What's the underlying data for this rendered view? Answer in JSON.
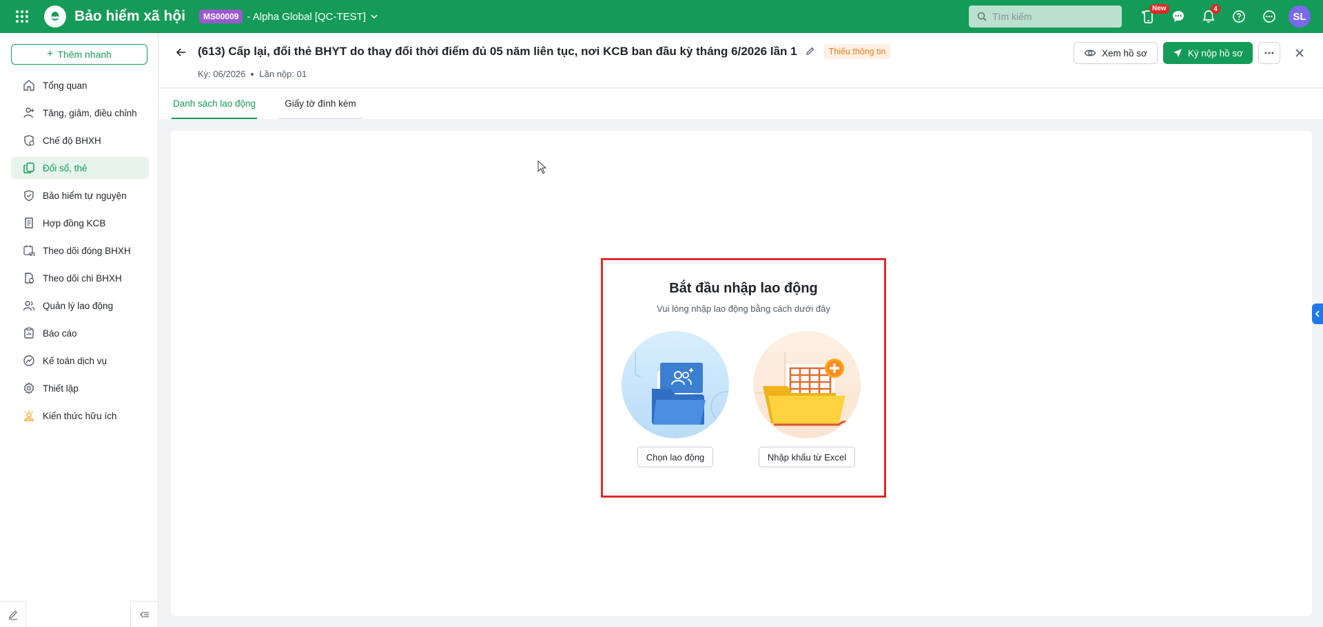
{
  "topbar": {
    "app_title": "Bảo hiểm xã hội",
    "org_code": "MS00009",
    "org_name": "- Alpha Global [QC-TEST]",
    "search_placeholder": "Tìm kiếm",
    "mobile_badge": "New",
    "notification_count": "4",
    "avatar_initials": "SL",
    "brand_color": "#149b57"
  },
  "sidebar": {
    "quick_add": "Thêm nhanh",
    "items": [
      {
        "label": "Tổng quan",
        "icon": "home-icon"
      },
      {
        "label": "Tăng, giảm, điều chỉnh",
        "icon": "user-adjust-icon"
      },
      {
        "label": "Chế độ BHXH",
        "icon": "shield-heart-icon"
      },
      {
        "label": "Đổi sổ, thẻ",
        "icon": "copy-card-icon"
      },
      {
        "label": "Bảo hiểm tự nguyện",
        "icon": "shield-icon"
      },
      {
        "label": "Hợp đồng KCB",
        "icon": "contract-icon"
      },
      {
        "label": "Theo dõi đóng BHXH",
        "icon": "calendar-c12-icon"
      },
      {
        "label": "Theo dõi chi BHXH",
        "icon": "document-money-icon"
      },
      {
        "label": "Quản lý lao động",
        "icon": "users-icon"
      },
      {
        "label": "Báo cáo",
        "icon": "clipboard-icon"
      },
      {
        "label": "Kế toán dịch vụ",
        "icon": "chart-circle-icon"
      },
      {
        "label": "Thiết lập",
        "icon": "gear-icon"
      },
      {
        "label": "Kiến thức hữu ích",
        "icon": "lightbulb-person-icon"
      }
    ],
    "active_index": 3
  },
  "header": {
    "title": "(613) Cấp lại, đổi thẻ BHYT do thay đổi thời điểm đủ 05 năm liên tục, nơi KCB ban đầu kỳ tháng 6/2026 lần 1",
    "status": "Thiếu thông tin",
    "period": "Kỳ: 06/2026",
    "submission": "Lần nộp: 01",
    "view_button": "Xem hồ sơ",
    "submit_button": "Ký nộp hồ sơ"
  },
  "tabs": [
    {
      "label": "Danh sách lao động",
      "active": true
    },
    {
      "label": "Giấy tờ đính kèm",
      "active": false
    }
  ],
  "start_panel": {
    "title": "Bắt đầu nhập lao động",
    "subtitle": "Vui lòng nhập lao động bằng cách dưới đây",
    "choose_button": "Chọn lao động",
    "import_button": "Nhập khẩu từ Excel"
  }
}
